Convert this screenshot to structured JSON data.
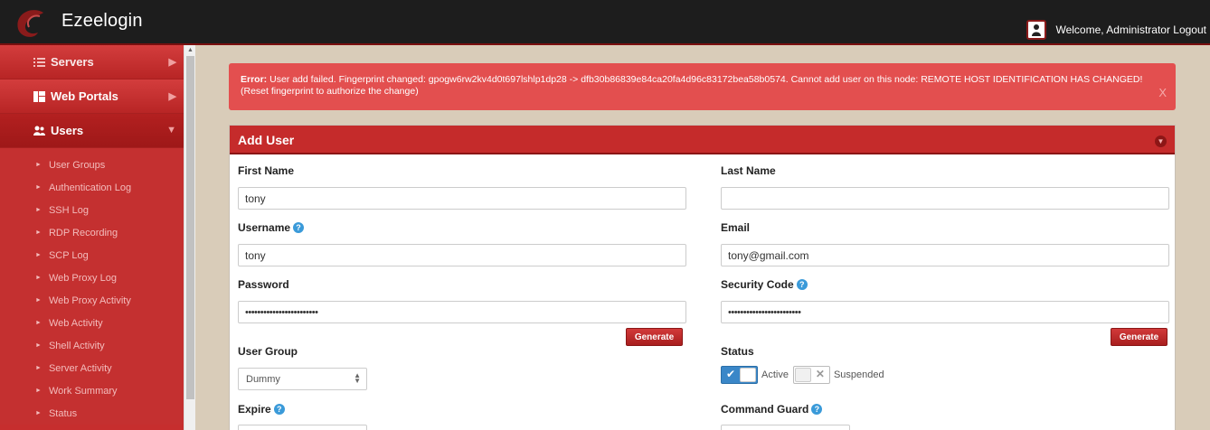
{
  "app": {
    "brand": "Ezeelogin",
    "welcome": "Welcome, Administrator Logout"
  },
  "sidebar": {
    "main_items": [
      {
        "label": "Servers",
        "icon": "list-icon"
      },
      {
        "label": "Web Portals",
        "icon": "dashboard-icon"
      },
      {
        "label": "Users",
        "icon": "users-icon"
      }
    ],
    "sub_items": [
      "User Groups",
      "Authentication Log",
      "SSH Log",
      "RDP Recording",
      "SCP Log",
      "Web Proxy Log",
      "Web Proxy Activity",
      "Web Activity",
      "Shell Activity",
      "Server Activity",
      "Work Summary",
      "Status"
    ]
  },
  "error": {
    "prefix": "Error:",
    "message": " User add failed. Fingerprint changed: gpogw6rw2kv4d0t697lshlp1dp28 -> dfb30b86839e84ca20fa4d96c83172bea58b0574. Cannot add user on this node: REMOTE HOST IDENTIFICATION HAS CHANGED!",
    "message2": "(Reset fingerprint to authorize the change)",
    "close": "X"
  },
  "form": {
    "title": "Add User",
    "first_name": {
      "label": "First Name",
      "value": "tony"
    },
    "last_name": {
      "label": "Last Name",
      "value": ""
    },
    "username": {
      "label": "Username",
      "value": "tony"
    },
    "email": {
      "label": "Email",
      "value": "tony@gmail.com"
    },
    "password": {
      "label": "Password",
      "value": "••••••••••••••••••••••••"
    },
    "security_code": {
      "label": "Security Code",
      "value": "••••••••••••••••••••••••"
    },
    "generate": "Generate",
    "user_group": {
      "label": "User Group",
      "value": "Dummy"
    },
    "status": {
      "label": "Status",
      "active": "Active",
      "suspended": "Suspended",
      "active_on": true
    },
    "expire": {
      "label": "Expire"
    },
    "command_guard": {
      "label": "Command Guard"
    }
  },
  "colors": {
    "accent": "#c52b2b",
    "error_bg": "#e34f4f",
    "sidebar_bg": "#c62e2e",
    "toggle_on": "#3a87c8"
  }
}
